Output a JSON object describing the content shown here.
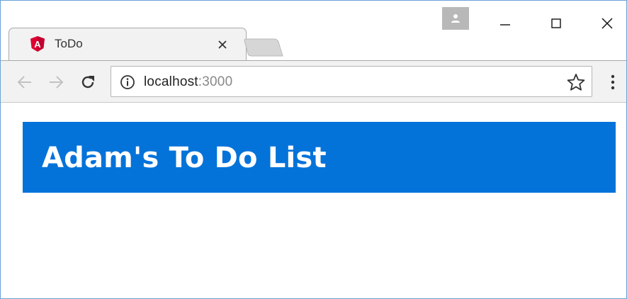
{
  "browser": {
    "tab": {
      "title": "ToDo",
      "icon": "angular-icon",
      "icon_letter": "A"
    },
    "address_bar": {
      "host": "localhost",
      "port": ":3000"
    }
  },
  "page": {
    "header_title": "Adam's To Do List"
  },
  "colors": {
    "header_background": "#0473d9",
    "header_text": "#ffffff",
    "angular_red": "#dd0031"
  }
}
